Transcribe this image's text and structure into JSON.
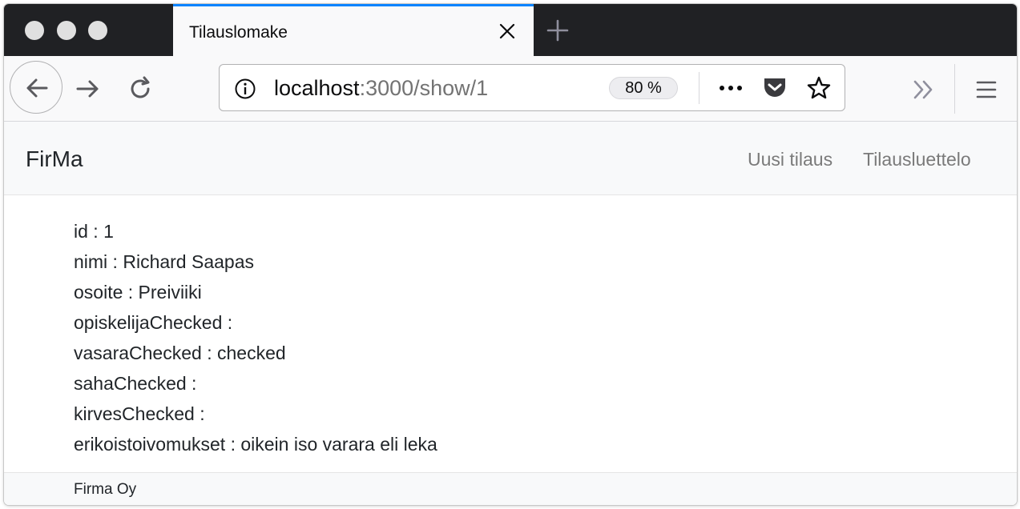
{
  "browser": {
    "tab": {
      "title": "Tilauslomake"
    },
    "url": {
      "host": "localhost",
      "path": ":3000/show/1"
    },
    "zoom": "80 %"
  },
  "navbar": {
    "brand": "FirMa",
    "links": [
      "Uusi tilaus",
      "Tilausluettelo"
    ]
  },
  "order": {
    "fields": [
      {
        "key": "id",
        "value": "1"
      },
      {
        "key": "nimi",
        "value": "Richard Saapas"
      },
      {
        "key": "osoite",
        "value": "Preiviiki"
      },
      {
        "key": "opiskelijaChecked",
        "value": ""
      },
      {
        "key": "vasaraChecked",
        "value": "checked"
      },
      {
        "key": "sahaChecked",
        "value": ""
      },
      {
        "key": "kirvesChecked",
        "value": ""
      },
      {
        "key": "erikoistoivomukset",
        "value": "oikein iso varara eli leka"
      }
    ]
  },
  "footer": {
    "text": "Firma Oy"
  },
  "icons": {
    "tab_close": "close-icon",
    "new_tab": "plus-icon",
    "back": "arrow-left-icon",
    "forward": "arrow-right-icon",
    "reload": "reload-icon",
    "site_info": "info-icon",
    "page_actions": "more-dots-icon",
    "pocket": "pocket-icon",
    "bookmark": "star-icon",
    "overflow": "double-chevron-icon",
    "menu": "hamburger-menu-icon"
  },
  "colors": {
    "tab_accent": "#0a84ff",
    "tabstrip": "#202124"
  }
}
